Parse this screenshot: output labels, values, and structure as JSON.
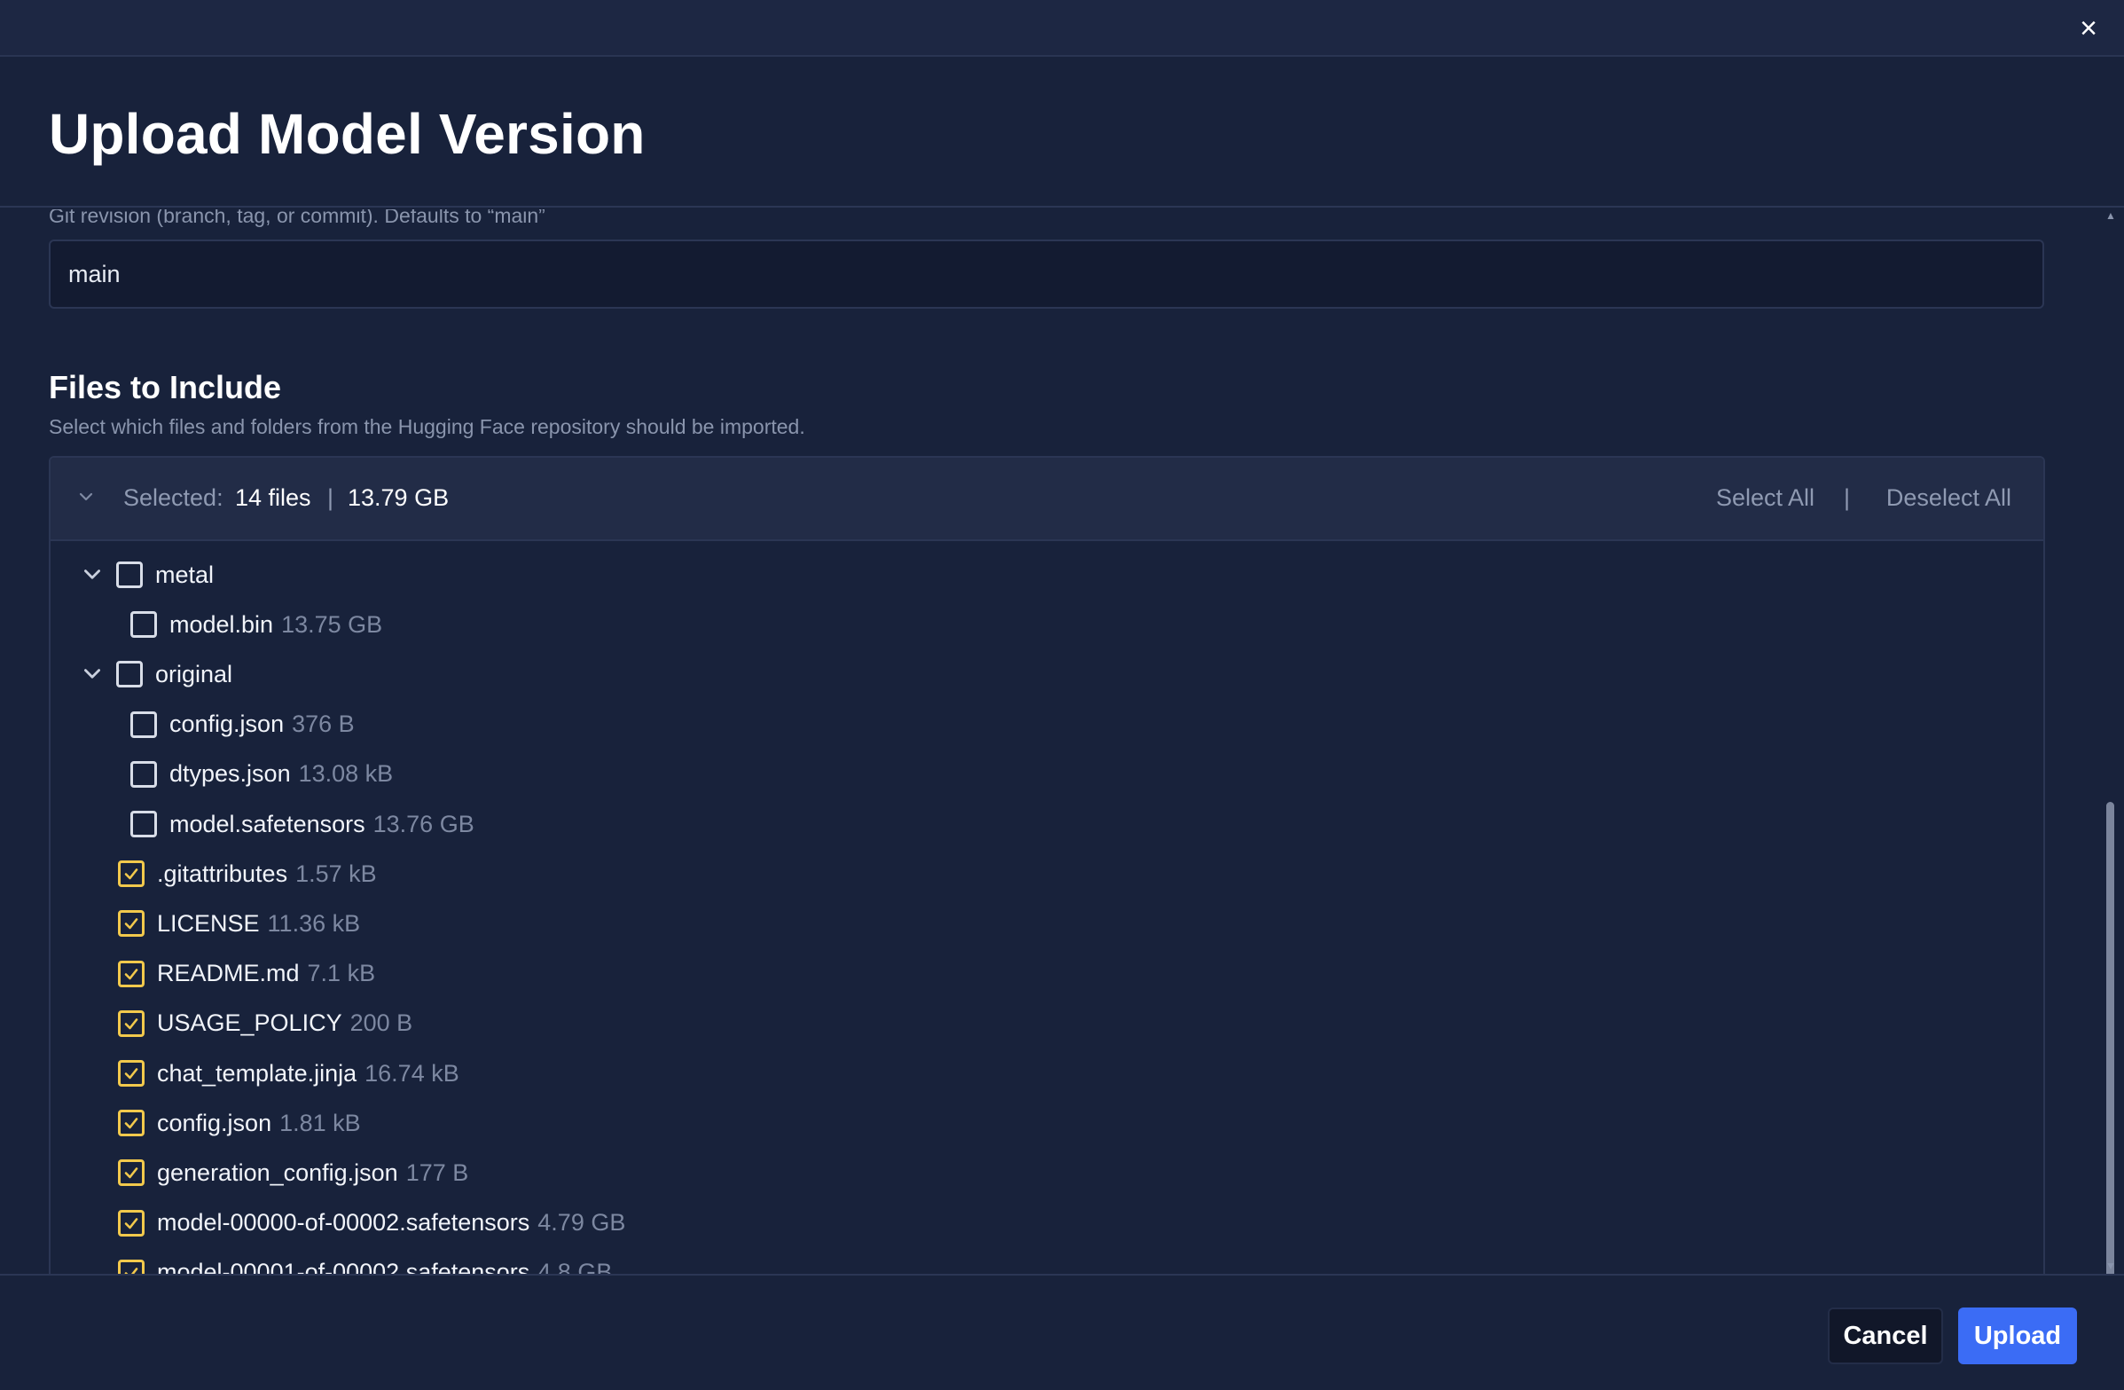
{
  "window": {
    "title": "Upload Model Version",
    "close_label": "×"
  },
  "revision": {
    "hint": "Git revision (branch, tag, or commit). Defaults to “main”",
    "value": "main"
  },
  "files_section": {
    "title": "Files to Include",
    "description": "Select which files and folders from the Hugging Face repository should be imported.",
    "selected_label": "Selected:",
    "selected_count": "14 files",
    "separator": "|",
    "selected_size": "13.79 GB",
    "select_all_label": "Select All",
    "deselect_all_label": "Deselect All"
  },
  "tree": [
    {
      "type": "folder",
      "name": "metal",
      "size": "",
      "checked": false,
      "depth": 0,
      "expanded": true
    },
    {
      "type": "file",
      "name": "model.bin",
      "size": "13.75 GB",
      "checked": false,
      "depth": 1
    },
    {
      "type": "folder",
      "name": "original",
      "size": "",
      "checked": false,
      "depth": 0,
      "expanded": true
    },
    {
      "type": "file",
      "name": "config.json",
      "size": "376 B",
      "checked": false,
      "depth": 1
    },
    {
      "type": "file",
      "name": "dtypes.json",
      "size": "13.08 kB",
      "checked": false,
      "depth": 1
    },
    {
      "type": "file",
      "name": "model.safetensors",
      "size": "13.76 GB",
      "checked": false,
      "depth": 1
    },
    {
      "type": "file",
      "name": ".gitattributes",
      "size": "1.57 kB",
      "checked": true,
      "depth": 0
    },
    {
      "type": "file",
      "name": "LICENSE",
      "size": "11.36 kB",
      "checked": true,
      "depth": 0
    },
    {
      "type": "file",
      "name": "README.md",
      "size": "7.1 kB",
      "checked": true,
      "depth": 0
    },
    {
      "type": "file",
      "name": "USAGE_POLICY",
      "size": "200 B",
      "checked": true,
      "depth": 0
    },
    {
      "type": "file",
      "name": "chat_template.jinja",
      "size": "16.74 kB",
      "checked": true,
      "depth": 0
    },
    {
      "type": "file",
      "name": "config.json",
      "size": "1.81 kB",
      "checked": true,
      "depth": 0
    },
    {
      "type": "file",
      "name": "generation_config.json",
      "size": "177 B",
      "checked": true,
      "depth": 0
    },
    {
      "type": "file",
      "name": "model-00000-of-00002.safetensors",
      "size": "4.79 GB",
      "checked": true,
      "depth": 0
    },
    {
      "type": "file",
      "name": "model-00001-of-00002.safetensors",
      "size": "4.8 GB",
      "checked": true,
      "depth": 0
    }
  ],
  "footer": {
    "cancel_label": "Cancel",
    "upload_label": "Upload"
  },
  "icons": {
    "close": "close-icon",
    "chevron": "chevron-down-icon",
    "check": "checkmark-icon"
  },
  "colors": {
    "background": "#18223b",
    "checked_accent": "#f2c94c",
    "primary_button": "#3b6cf5"
  }
}
